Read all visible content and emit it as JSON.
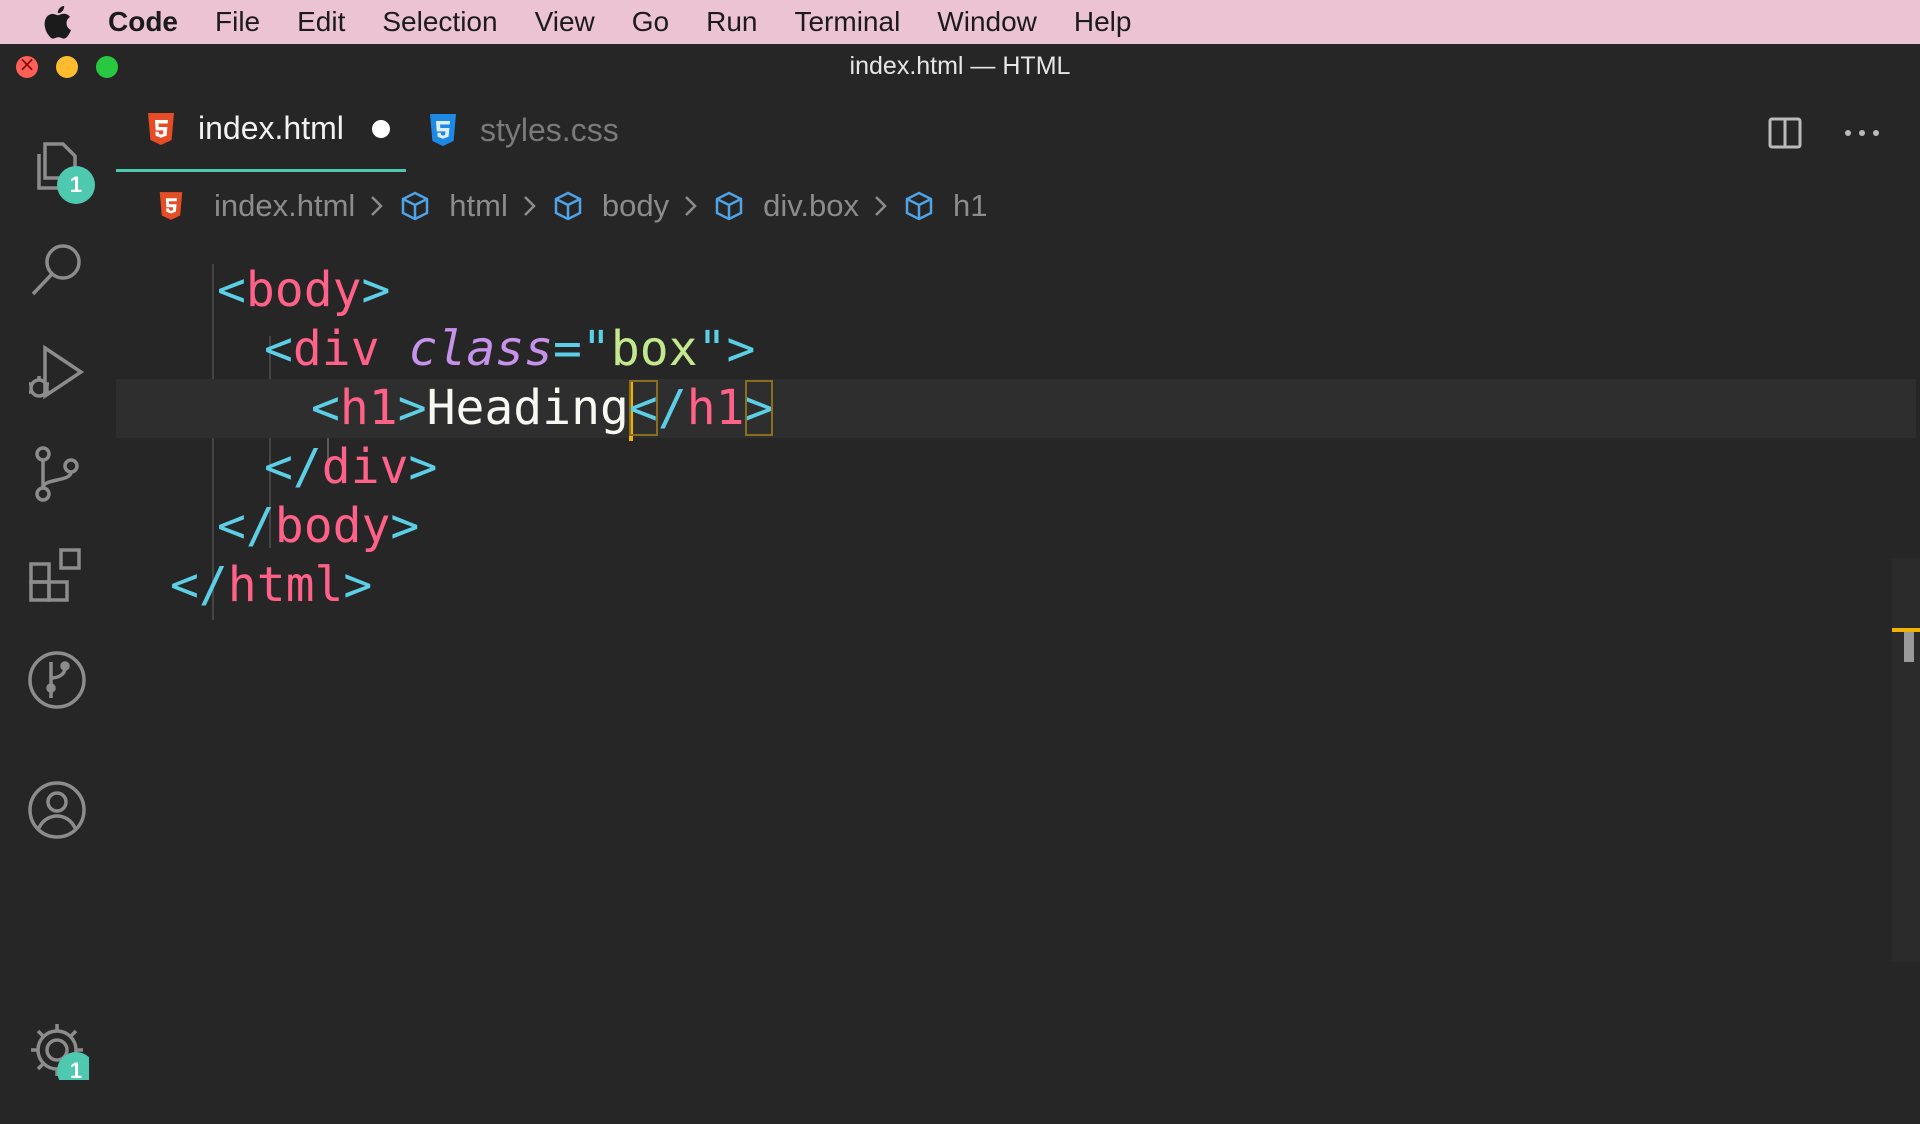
{
  "menubar": {
    "app_name": "Code",
    "items": [
      "File",
      "Edit",
      "Selection",
      "View",
      "Go",
      "Run",
      "Terminal",
      "Window",
      "Help"
    ]
  },
  "window": {
    "title": "index.html — HTML"
  },
  "activity_bar": {
    "explorer_badge": "1",
    "settings_badge": "1",
    "icons": [
      "files-icon",
      "search-icon",
      "run-debug-icon",
      "source-control-icon",
      "extensions-icon",
      "git-graph-icon",
      "account-icon",
      "settings-gear-icon"
    ]
  },
  "tabs": [
    {
      "label": "index.html",
      "icon": "html5-icon",
      "active": true,
      "modified": true
    },
    {
      "label": "styles.css",
      "icon": "css3-icon",
      "active": false,
      "modified": false
    }
  ],
  "breadcrumbs": [
    "index.html",
    "html",
    "body",
    "div.box",
    "h1"
  ],
  "editor": {
    "lines": [
      {
        "indent": 2,
        "tokens": [
          [
            "br",
            "<"
          ],
          [
            "tag",
            "body"
          ],
          [
            "br",
            ">"
          ]
        ]
      },
      {
        "indent": 4,
        "tokens": [
          [
            "br",
            "<"
          ],
          [
            "tag",
            "div"
          ],
          [
            "sp",
            " "
          ],
          [
            "attr",
            "class"
          ],
          [
            "eq",
            "="
          ],
          [
            "q",
            "\""
          ],
          [
            "str",
            "box"
          ],
          [
            "q",
            "\""
          ],
          [
            "br",
            ">"
          ]
        ]
      },
      {
        "indent": 6,
        "tokens": [
          [
            "br",
            "<"
          ],
          [
            "tag",
            "h1"
          ],
          [
            "br",
            ">"
          ],
          [
            "text",
            "Heading"
          ],
          [
            "cursor",
            ""
          ],
          [
            "brm",
            "<"
          ],
          [
            "br",
            "/"
          ],
          [
            "tag",
            "h1"
          ],
          [
            "brm",
            ">"
          ]
        ],
        "current": true
      },
      {
        "indent": 4,
        "tokens": [
          [
            "br",
            "</"
          ],
          [
            "tag",
            "div"
          ],
          [
            "br",
            ">"
          ]
        ]
      },
      {
        "indent": 2,
        "tokens": [
          [
            "br",
            "</"
          ],
          [
            "tag",
            "body"
          ],
          [
            "br",
            ">"
          ]
        ]
      },
      {
        "indent": 0,
        "tokens": [
          [
            "br",
            "</"
          ],
          [
            "tag",
            "html"
          ],
          [
            "br",
            ">"
          ]
        ]
      }
    ]
  },
  "colors": {
    "menubar_bg": "#ecc3d2",
    "editor_bg": "#262626",
    "accent": "#4ec9b0",
    "tag": "#ff6188",
    "bracket": "#5ccfe6",
    "attribute": "#c792ea",
    "string": "#c3e88d",
    "cursor": "#f0b400"
  }
}
